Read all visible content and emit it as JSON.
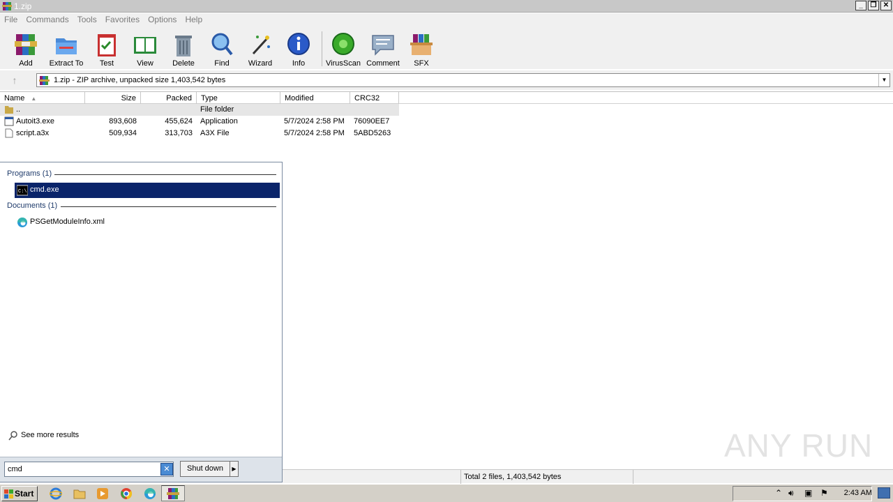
{
  "window": {
    "title": "1.zip"
  },
  "menu": [
    "File",
    "Commands",
    "Tools",
    "Favorites",
    "Options",
    "Help"
  ],
  "toolbar": [
    {
      "label": "Add",
      "icon": "add-archive-icon"
    },
    {
      "label": "Extract To",
      "icon": "extract-folder-icon"
    },
    {
      "label": "Test",
      "icon": "test-clipboard-icon"
    },
    {
      "label": "View",
      "icon": "view-book-icon"
    },
    {
      "label": "Delete",
      "icon": "trash-can-icon"
    },
    {
      "label": "Find",
      "icon": "magnifier-icon"
    },
    {
      "label": "Wizard",
      "icon": "magic-wand-icon"
    },
    {
      "label": "Info",
      "icon": "info-icon"
    },
    {
      "label": "VirusScan",
      "icon": "virus-scan-icon"
    },
    {
      "label": "Comment",
      "icon": "comment-icon"
    },
    {
      "label": "SFX",
      "icon": "sfx-box-icon"
    }
  ],
  "address": {
    "text": "1.zip - ZIP archive, unpacked size 1,403,542 bytes"
  },
  "columns": {
    "name": "Name",
    "size": "Size",
    "packed": "Packed",
    "type": "Type",
    "modified": "Modified",
    "crc": "CRC32"
  },
  "files": [
    {
      "name": "..",
      "size": "",
      "packed": "",
      "type": "File folder",
      "modified": "",
      "crc": ""
    },
    {
      "name": "Autoit3.exe",
      "size": "893,608",
      "packed": "455,624",
      "type": "Application",
      "modified": "5/7/2024 2:58 PM",
      "crc": "76090EE7"
    },
    {
      "name": "script.a3x",
      "size": "509,934",
      "packed": "313,703",
      "type": "A3X File",
      "modified": "5/7/2024 2:58 PM",
      "crc": "5ABD5263"
    }
  ],
  "startmenu": {
    "programs_header": "Programs (1)",
    "program_item": "cmd.exe",
    "documents_header": "Documents (1)",
    "document_item": "PSGetModuleInfo.xml",
    "see_more": "See more results",
    "search_value": "cmd",
    "shutdown_label": "Shut down"
  },
  "status": {
    "total": "Total 2 files, 1,403,542 bytes"
  },
  "taskbar": {
    "start_label": "Start",
    "clock": "2:43 AM"
  },
  "watermark": "ANY RUN",
  "colors": {
    "selection": "#0a246a",
    "menu_text": "#7a7a7a"
  }
}
